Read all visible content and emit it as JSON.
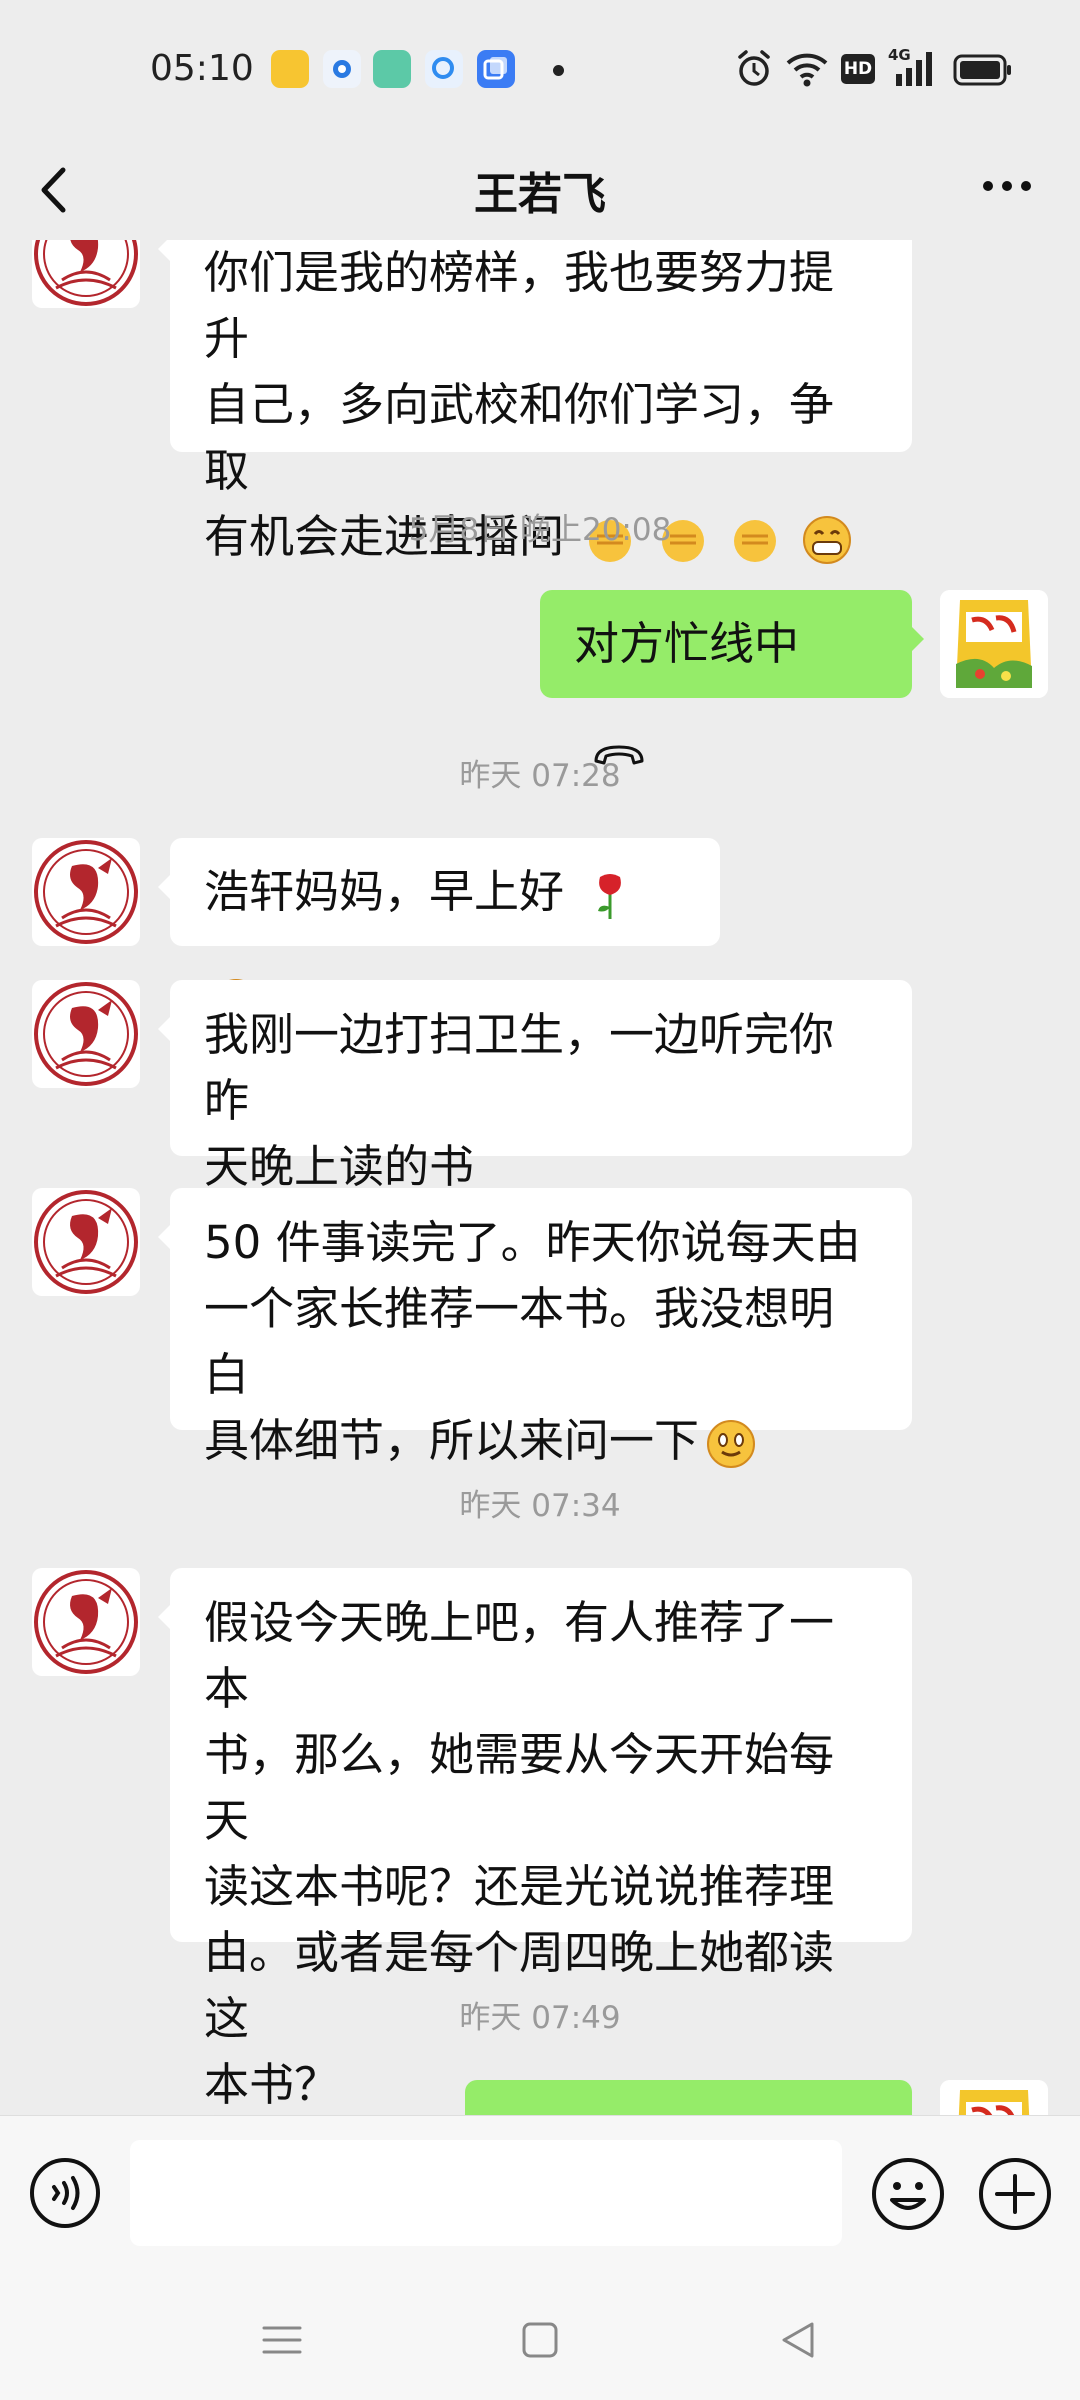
{
  "status_bar": {
    "time": "05:10",
    "hd_label": "HD",
    "network_label": "4G"
  },
  "header": {
    "title": "王若飞"
  },
  "messages": {
    "m0": {
      "lines": [
        "你们是我的榜样，我也要努力提升",
        "自己，多向武校和你们学习，争取",
        "有机会走进直播间"
      ],
      "emojis": [
        "fist-emoji",
        "fist-emoji",
        "fist-emoji",
        "grin-emoji"
      ]
    },
    "t1": "5月8日 晚上20:08",
    "m1": {
      "text": "对方忙线中",
      "icon": "hangup-icon"
    },
    "t2": "昨天 07:28",
    "m2": {
      "text": "浩轩妈妈，早上好",
      "emojis": [
        "rose-emoji",
        "smile-emoji"
      ]
    },
    "m3": {
      "lines": [
        "我刚一边打扫卫生，一边听完你昨",
        "天晚上读的书"
      ]
    },
    "m4": {
      "lines": [
        "50 件事读完了。昨天你说每天由",
        "一个家长推荐一本书。我没想明白",
        "具体细节，所以来问一下"
      ],
      "emojis": [
        "smile-emoji"
      ]
    },
    "t3": "昨天 07:34",
    "m5": {
      "lines": [
        "假设今天晚上吧，有人推荐了一本",
        "书，那么，她需要从今天开始每天",
        "读这本书呢？还是光说说推荐理",
        "由。或者是每个周四晚上她都读这",
        "本书？"
      ]
    },
    "t4": "昨天 07:49"
  },
  "colors": {
    "background": "#ededed",
    "incoming_bubble": "#ffffff",
    "outgoing_bubble": "#95ec69",
    "avatar_red": "#b3262d",
    "timestamp": "#9a9a9a"
  }
}
